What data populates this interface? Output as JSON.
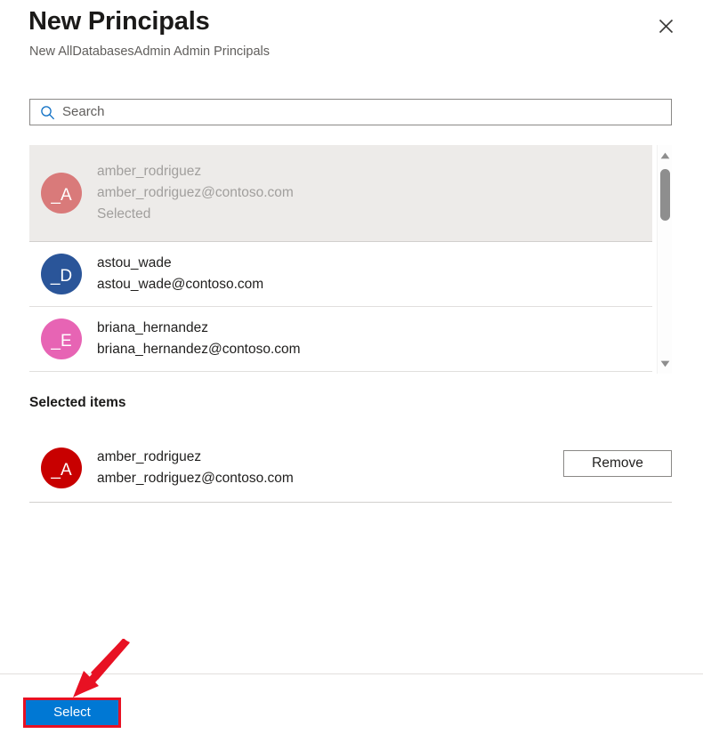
{
  "header": {
    "title": "New Principals",
    "subtitle": "New AllDatabasesAdmin Admin Principals",
    "close_icon": "close-icon"
  },
  "search": {
    "placeholder": "Search",
    "value": "",
    "icon": "search-icon"
  },
  "results": {
    "items": [
      {
        "name": "amber_rodriguez",
        "email": "amber_rodriguez@contoso.com",
        "state": "Selected",
        "initials": "_A",
        "avatar_color": "#d97a7a",
        "is_selected": true
      },
      {
        "name": "astou_wade",
        "email": "astou_wade@contoso.com",
        "state": "",
        "initials": "_D",
        "avatar_color": "#2a5599",
        "is_selected": false
      },
      {
        "name": "briana_hernandez",
        "email": "briana_hernandez@contoso.com",
        "state": "",
        "initials": "_E",
        "avatar_color": "#e764b4",
        "is_selected": false
      }
    ],
    "scrollbar": {
      "up_arrow_icon": "chevron-up-icon",
      "down_arrow_icon": "chevron-down-icon",
      "thumb": "scrollbar-thumb"
    }
  },
  "selected_items": {
    "heading": "Selected items",
    "items": [
      {
        "name": "amber_rodriguez",
        "email": "amber_rodriguez@contoso.com",
        "initials": "_A",
        "avatar_color": "#c80000",
        "remove_label": "Remove"
      }
    ]
  },
  "footer": {
    "select_label": "Select"
  },
  "annotations": {
    "highlight_color": "#e81123",
    "arrow": "red-arrow-pointing-to-select-button"
  },
  "colors": {
    "accent": "#0078d4",
    "annotation_red": "#e81123",
    "text_primary": "#201f1e",
    "text_secondary": "#605e5c",
    "text_disabled": "#a19f9d"
  }
}
